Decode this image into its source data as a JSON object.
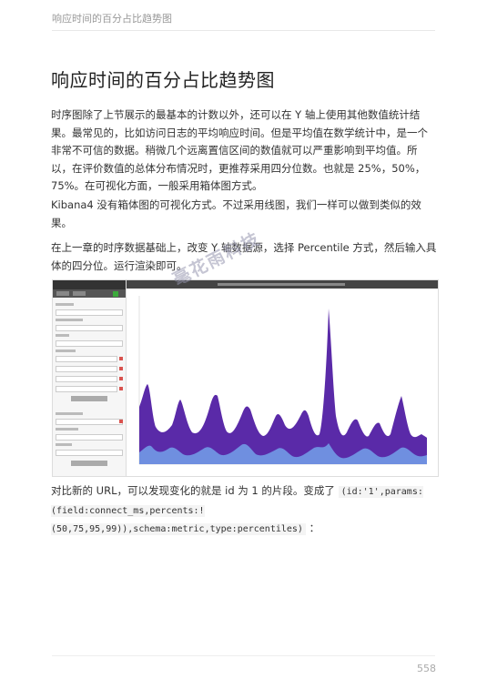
{
  "header": {
    "running_title": "响应时间的百分占比趋势图"
  },
  "section": {
    "title": "响应时间的百分占比趋势图"
  },
  "paragraphs": {
    "p1": "时序图除了上节展示的最基本的计数以外，还可以在 Y 轴上使用其他数值统计结果。最常见的，比如访问日志的平均响应时间。但是平均值在数学统计中，是一个非常不可信的数据。稍微几个远离置信区间的数值就可以严重影响到平均值。所以，在评价数值的总体分布情况时，更推荐采用四分位数。也就是 25%，50%，75%。在可视化方面，一般采用箱体图方式。",
    "p2": "Kibana4 没有箱体图的可视化方式。不过采用线图，我们一样可以做到类似的效果。",
    "p3": "在上一章的时序数据基础上，改变 Y 轴数据源，选择 Percentile 方式，然后输入具体的四分位。运行渲染即可。",
    "p4_before": "对比新的 URL，可以发现变化的就是 id 为 1 的片段。变成了 ",
    "p4_code": "(id:'1',params:(field:connect_ms,percents:!(50,75,95,99)),schema:metric,type:percentiles)",
    "p4_after": " ："
  },
  "watermark": {
    "text": "毫花雨科技"
  },
  "footer": {
    "page_number": "558"
  },
  "colors": {
    "series_dark": "#5a2aa8",
    "series_light": "#6f8fe0",
    "sidebar_bg": "#f6f6f6"
  },
  "icons": {
    "add": "green-plus-square",
    "remove": "red-x-square"
  }
}
